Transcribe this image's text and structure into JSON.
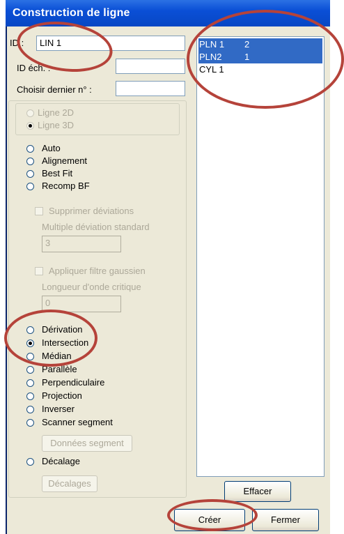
{
  "window": {
    "title": "Construction de ligne"
  },
  "fields": {
    "id_label": "ID :",
    "id_value": "LIN 1",
    "id_ech_label": "ID éch. :",
    "id_ech_value": "",
    "dernier_label": "Choisir dernier n° :",
    "dernier_value": ""
  },
  "line_type": {
    "options": [
      "Ligne 2D",
      "Ligne 3D"
    ],
    "selected": "Ligne 3D"
  },
  "fit_methods": [
    "Auto",
    "Alignement",
    "Best Fit",
    "Recomp BF"
  ],
  "deviation": {
    "checkbox_label": "Supprimer déviations",
    "multiple_label": "Multiple déviation standard",
    "multiple_value": "3"
  },
  "gauss": {
    "checkbox_label": "Appliquer filtre gaussien",
    "wavelength_label": "Longueur d'onde critique",
    "wavelength_value": "0"
  },
  "construction_methods": [
    "Dérivation",
    "Intersection",
    "Médian",
    "Parallèle",
    "Perpendiculaire",
    "Projection",
    "Inverser",
    "Scanner segment"
  ],
  "selected_method": "Intersection",
  "segment_button": "Données segment",
  "offset": {
    "label": "Décalage",
    "button": "Décalages"
  },
  "features": [
    {
      "name": "PLN 1",
      "count": "2",
      "selected": true
    },
    {
      "name": "PLN2",
      "count": "1",
      "selected": true
    },
    {
      "name": "CYL 1",
      "count": "",
      "selected": false
    }
  ],
  "buttons": {
    "clear": "Effacer",
    "create": "Créer",
    "close": "Fermer"
  },
  "colors": {
    "title_bar": "#0a4fd6",
    "selection": "#316ac5",
    "highlight_circle": "#b5433a",
    "dialog_bg": "#ece9d8"
  }
}
